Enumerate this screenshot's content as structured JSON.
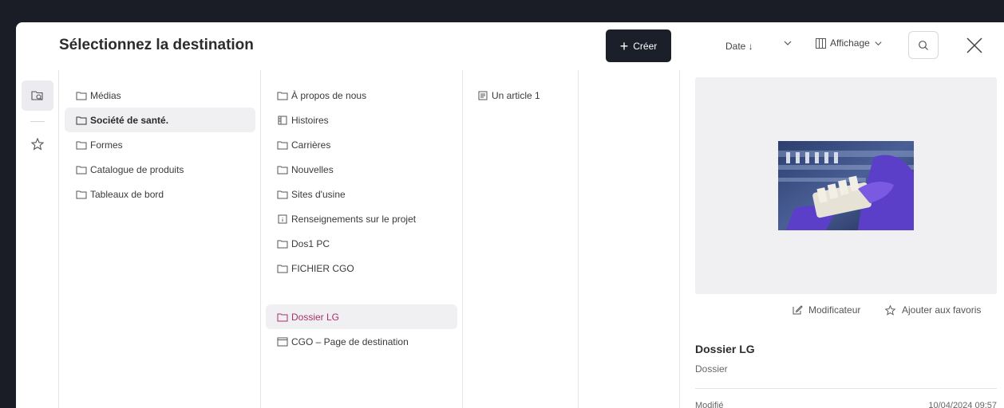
{
  "header": {
    "title": "Sélectionnez la destination",
    "create_label": "Créer",
    "sort_label": "Date ↓",
    "view_label": "Affichage"
  },
  "rail": {
    "items": [
      {
        "icon": "browse-search-icon",
        "active": true
      },
      {
        "icon": "star-icon",
        "active": false
      }
    ]
  },
  "columns": {
    "col1": [
      {
        "label": "Médias",
        "icon": "folder-icon"
      },
      {
        "label": "Société de santé.",
        "icon": "folder-icon",
        "selected": true
      },
      {
        "label": "Formes",
        "icon": "folder-icon"
      },
      {
        "label": "Catalogue de produits",
        "icon": "folder-icon"
      },
      {
        "label": "Tableaux de bord",
        "icon": "folder-icon"
      }
    ],
    "col2": [
      {
        "label": "À propos de nous",
        "icon": "folder-icon"
      },
      {
        "label": "Histoires",
        "icon": "stories-icon"
      },
      {
        "label": "Carrières",
        "icon": "folder-icon"
      },
      {
        "label": "Nouvelles",
        "icon": "folder-icon"
      },
      {
        "label": "Sites d'usine",
        "icon": "folder-icon"
      },
      {
        "label": "Renseignements sur le projet",
        "icon": "info-page-icon"
      },
      {
        "label": "Dos1 PC",
        "icon": "folder-icon"
      },
      {
        "label": "FICHIER CGO",
        "icon": "folder-icon"
      },
      {
        "label": "Dossier LG",
        "icon": "folder-icon",
        "selected": true
      },
      {
        "label": "CGO – Page de destination",
        "icon": "page-icon"
      }
    ],
    "col3": [
      {
        "label": "Un article 1",
        "icon": "article-icon"
      }
    ]
  },
  "detail": {
    "modifier_label": "Modificateur",
    "favorite_label": "Ajouter aux favoris",
    "name": "Dossier LG",
    "type": "Dossier",
    "modified_label": "Modifié",
    "modified_value": "10/04/2024 09:57"
  },
  "colors": {
    "dark_button": "#1b1f29",
    "selected_bg": "#f0f0f3",
    "accent_selected_text": "#a8316a"
  }
}
